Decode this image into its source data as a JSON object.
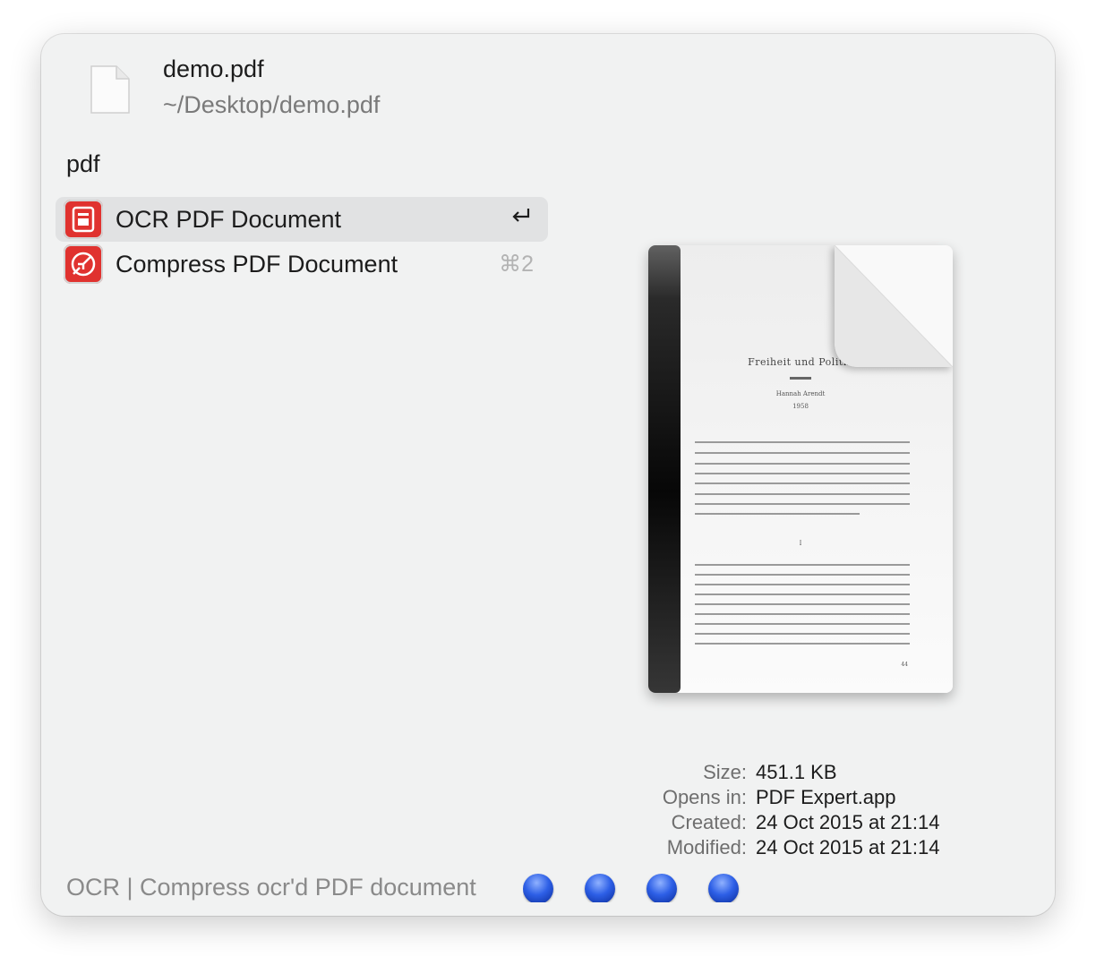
{
  "file": {
    "name": "demo.pdf",
    "path": "~/Desktop/demo.pdf",
    "icon": "document-icon"
  },
  "query": "pdf",
  "actions": [
    {
      "label": "OCR PDF Document",
      "shortcut": "↩",
      "selected": true,
      "icon": "ocr-icon",
      "color": "#e0322f"
    },
    {
      "label": "Compress PDF Document",
      "shortcut": "⌘2",
      "selected": false,
      "icon": "compress-icon",
      "color": "#e0322f"
    }
  ],
  "preview": {
    "title": "Freiheit und Politik",
    "author": "Hannah Arendt",
    "year": "1958",
    "section": "I",
    "page_number": "44"
  },
  "metadata": {
    "size_label": "Size:",
    "size": "451.1 KB",
    "opens_in_label": "Opens in:",
    "opens_in": "PDF Expert.app",
    "created_label": "Created:",
    "created": "24 Oct 2015 at 21:14",
    "modified_label": "Modified:",
    "modified": "24 Oct 2015 at 21:14"
  },
  "status_text": "OCR | Compress ocr'd PDF document",
  "progress_dots": 4
}
